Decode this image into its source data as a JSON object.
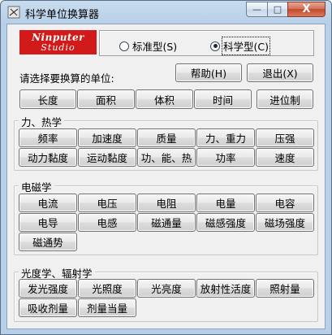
{
  "window": {
    "title": "科学单位换算器",
    "close_glyph": "X",
    "min_glyph": "—",
    "max_glyph": "□"
  },
  "logo": {
    "line1": "Ninputer",
    "line2": "Studio"
  },
  "mode": {
    "standard_label": "标准型(S)",
    "scientific_label": "科学型(C)",
    "selected": "scientific"
  },
  "prompt": "请选择要换算的单位:",
  "actions": {
    "help": "帮助(H)",
    "exit": "退出(X)"
  },
  "basic_units": [
    "长度",
    "面积",
    "体积",
    "时间",
    "进位制"
  ],
  "groups": [
    {
      "label": "力、热学",
      "items": [
        "频率",
        "加速度",
        "质量",
        "力、重力",
        "压强",
        "动力黏度",
        "运动黏度",
        "功、能、热",
        "功率",
        "速度"
      ]
    },
    {
      "label": "电磁学",
      "items": [
        "电流",
        "电压",
        "电阻",
        "电量",
        "电容",
        "电导",
        "电感",
        "磁通量",
        "磁感强度",
        "磁场强度",
        "磁通势"
      ]
    },
    {
      "label": "光度学、辐射学",
      "items": [
        "发光强度",
        "光照度",
        "光亮度",
        "放射性活度",
        "照射量",
        "吸收剂量",
        "剂量当量"
      ]
    }
  ],
  "colors": {
    "logo_red": "#d21a1a",
    "close_red": "#c4482b",
    "titlebar": "#b7cfe8"
  }
}
